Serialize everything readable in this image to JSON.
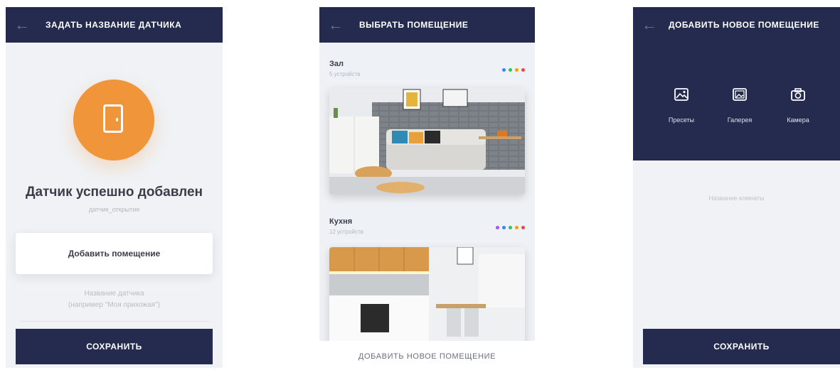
{
  "screen1": {
    "title": "ЗАДАТЬ НАЗВАНИЕ ДАТЧИКА",
    "icon": "door-icon",
    "success_text": "Датчик успешно добавлен",
    "sensor_subtitle": "датчик_открытия",
    "add_room_button": "Добавить помещение",
    "name_placeholder_line1": "Название датчика",
    "name_placeholder_line2": "(например \"Моя прихожая\")",
    "save_button": "СОХРАНИТЬ"
  },
  "screen2": {
    "title": "ВЫБРАТЬ ПОМЕЩЕНИЕ",
    "rooms": [
      {
        "name": "Зал",
        "count": "5 устройств",
        "dot_colors": [
          "#3b82f6",
          "#22c55e",
          "#f59e0b",
          "#ef4444"
        ]
      },
      {
        "name": "Кухня",
        "count": "12 устройств",
        "dot_colors": [
          "#a855f7",
          "#3b82f6",
          "#22c55e",
          "#f59e0b",
          "#ef4444"
        ]
      }
    ],
    "add_new_room": "ДОБАВИТЬ НОВОЕ ПОМЕЩЕНИЕ"
  },
  "screen3": {
    "title": "ДОБАВИТЬ НОВОЕ ПОМЕЩЕНИЕ",
    "options": [
      {
        "label": "Пресеты",
        "icon": "presets-icon"
      },
      {
        "label": "Галерея",
        "icon": "gallery-icon"
      },
      {
        "label": "Камера",
        "icon": "camera-icon"
      }
    ],
    "room_name_placeholder": "Название комнаты",
    "save_button": "СОХРАНИТЬ"
  },
  "colors": {
    "navy": "#242b4e",
    "accent_orange": "#f0953a",
    "background": "#f0f2f5"
  }
}
